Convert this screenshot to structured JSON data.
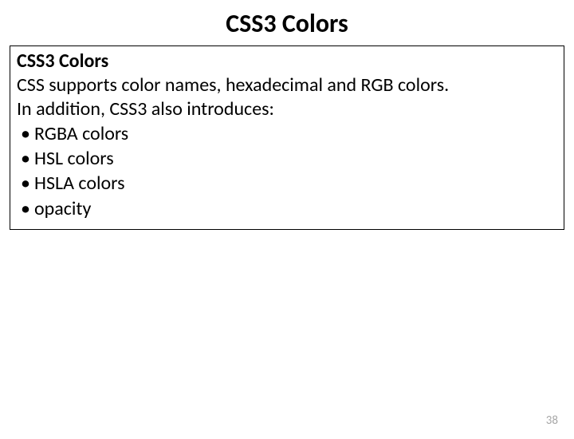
{
  "title": "CSS3 Colors",
  "box": {
    "heading": "CSS3 Colors",
    "line1": "CSS supports color names, hexadecimal and RGB colors.",
    "line2": "In addition, CSS3 also introduces:",
    "bullets": [
      "RGBA colors",
      "HSL colors",
      "HSLA colors",
      "opacity"
    ]
  },
  "page_number": "38"
}
